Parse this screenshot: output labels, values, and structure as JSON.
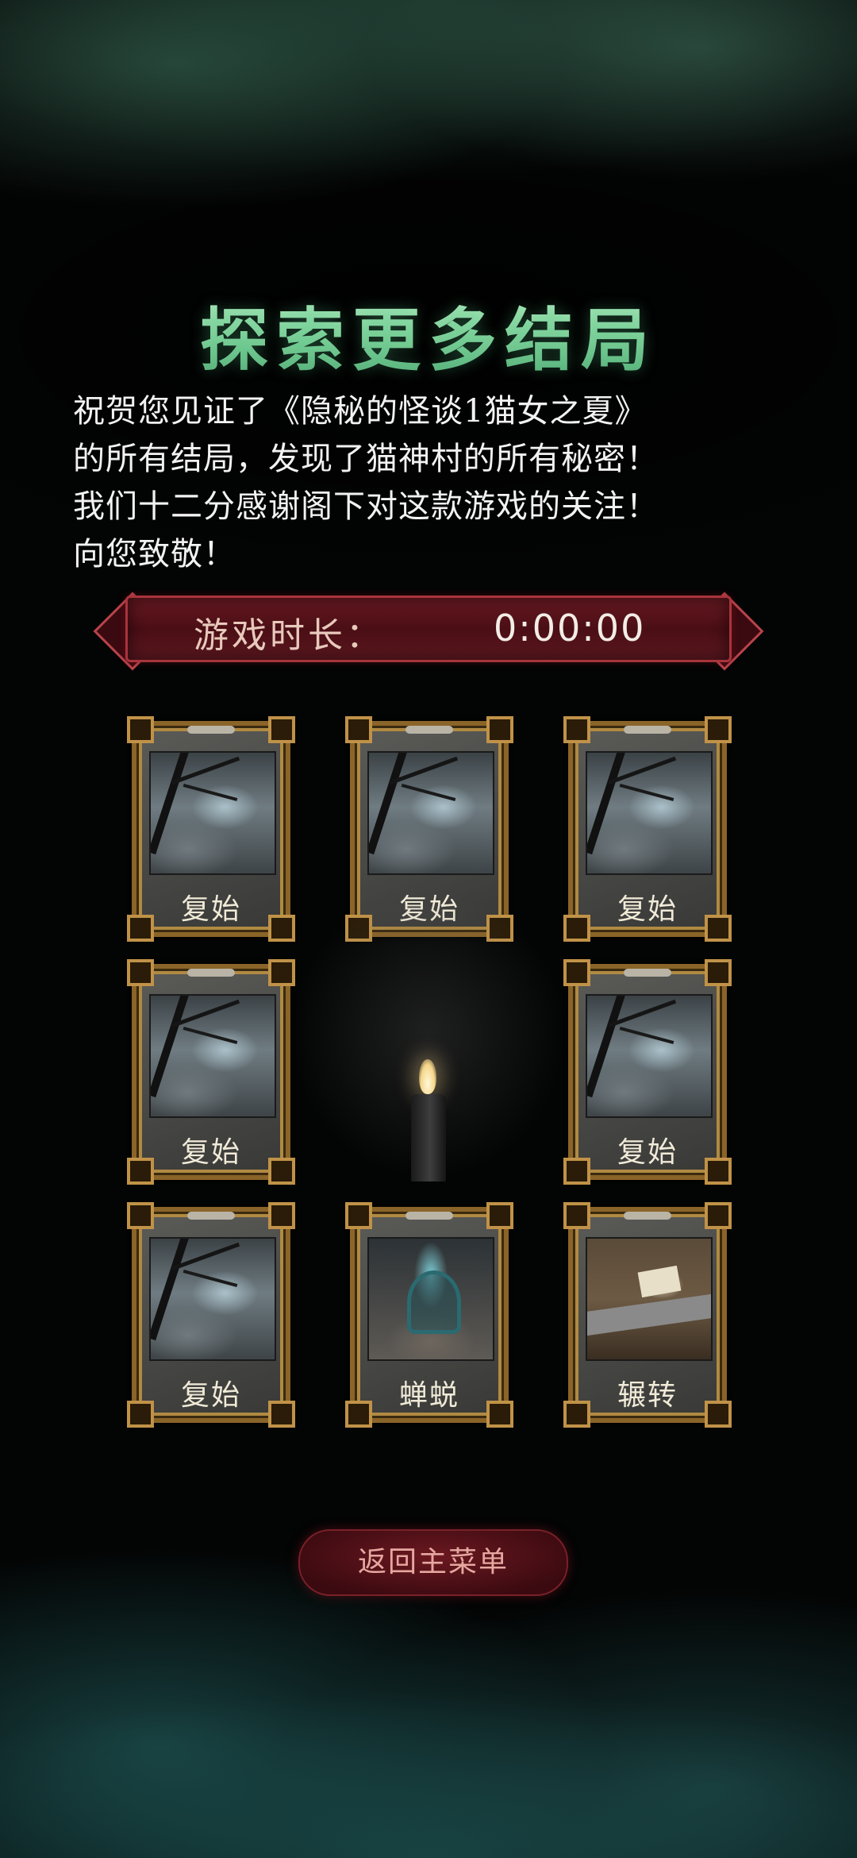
{
  "title": "探索更多结局",
  "intro_lines": [
    "祝贺您见证了《隐秘的怪谈1猫女之夏》",
    "的所有结局，发现了猫神村的所有秘密！",
    "我们十二分感谢阁下对这款游戏的关注！",
    "向您致敬！"
  ],
  "playtime": {
    "label": "游戏时长：",
    "value": "0:00:00"
  },
  "endings": [
    {
      "caption": "复始",
      "art": "forest"
    },
    {
      "caption": "复始",
      "art": "forest"
    },
    {
      "caption": "复始",
      "art": "forest"
    },
    {
      "caption": "复始",
      "art": "forest"
    },
    {
      "caption": "复始",
      "art": "forest"
    },
    {
      "caption": "复始",
      "art": "forest"
    },
    {
      "caption": "蝉蜕",
      "art": "throne"
    },
    {
      "caption": "辗转",
      "art": "desk"
    }
  ],
  "back_button": "返回主菜单",
  "colors": {
    "title": "#8fd9a8",
    "banner": "#5e1820",
    "button": "#6b1820"
  },
  "icons": {
    "candle": "candle-icon"
  }
}
